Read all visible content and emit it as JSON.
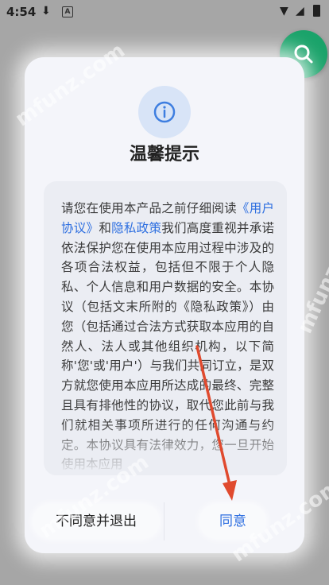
{
  "status_bar": {
    "time": "4:54"
  },
  "dialog": {
    "title": "温馨提示",
    "body": {
      "part1": "请您在使用本产品之前仔细阅读",
      "link1": "《用户协议》",
      "part2": "和",
      "link2": "隐私政策",
      "part3": "我们高度重视并承诺依法保护您在使用本应用过程中涉及的各项合法权益，包括但不限于个人隐私、个人信息和用户数据的安全。本协议（包括文末所附的《隐私政策》）由您（包括通过合法方式获取本应用的自然人、法人或其他组织机构，以下简称'您'或'用户'）与我们共同订立，是双方就您使用本应用所达成的最终、完整且具有排他性的协议，取代您此前与我们就相关事项所进行的任何沟通与约定。本协议具有法律效力，您一旦开始使用本应用"
    },
    "decline_label": "不同意并退出",
    "agree_label": "同意"
  },
  "watermark": "mfunz.com",
  "colors": {
    "accent": "#2e6fe0",
    "fab": "#1aa36a",
    "arrow": "#e04a2e"
  }
}
